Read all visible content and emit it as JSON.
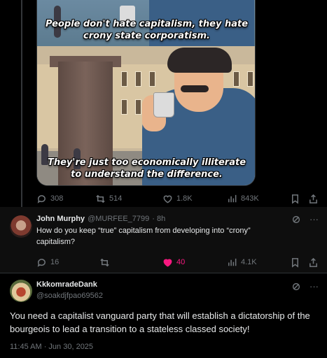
{
  "meme": {
    "caption_top": [
      "People don't hate capitalism, they hate",
      "crony state corporatism."
    ],
    "caption_bottom": [
      "They're just too economically illiterate",
      "to understand the difference."
    ]
  },
  "post_actions": {
    "replies": "308",
    "reposts": "514",
    "likes": "1.8K",
    "views": "843K"
  },
  "reply": {
    "display_name": "John Murphy",
    "handle": "@MURFEE_7799",
    "time": "· 8h",
    "text": [
      "How do you keep “true” capitalism from developing into “crony”",
      "capitalism?"
    ],
    "more": "···",
    "actions": {
      "replies": "16",
      "reposts": "",
      "likes": "40",
      "views": "4.1K"
    }
  },
  "main": {
    "display_name": "KkkomradeDank",
    "handle": "@soakdjfpao69562",
    "more": "···",
    "text": "You need a capitalist vanguard party that will establish a dictatorship of the bourgeois to lead a transition to a stateless classed society!",
    "timestamp": "11:45 AM · Jun 30, 2025"
  },
  "colors": {
    "background": "#000000",
    "text": "#e7e9ea",
    "muted": "#71767b",
    "like_active": "#f91880",
    "divider": "#2f3336"
  }
}
